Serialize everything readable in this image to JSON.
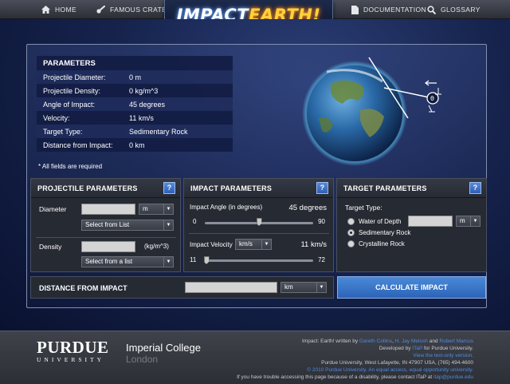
{
  "nav": {
    "home": "HOME",
    "famous_craters": "FAMOUS CRATERS",
    "documentation": "DOCUMENTATION",
    "glossary": "GLOSSARY",
    "logo_impact": "IMPACT",
    "logo_earth": "EARTH!"
  },
  "summary": {
    "heading": "PARAMETERS",
    "rows": [
      {
        "label": "Projectile Diameter:",
        "value": "0 m"
      },
      {
        "label": "Projectile Density:",
        "value": "0 kg/m^3"
      },
      {
        "label": "Angle of Impact:",
        "value": "45 degrees"
      },
      {
        "label": "Velocity:",
        "value": "11 km/s"
      },
      {
        "label": "Target Type:",
        "value": "Sedimentary Rock"
      },
      {
        "label": "Distance from Impact:",
        "value": "0 km"
      }
    ],
    "note": "* All fields are required"
  },
  "projectile": {
    "title": "PROJECTILE PARAMETERS",
    "help": "?",
    "diameter_label": "Diameter",
    "diameter_unit": "m",
    "diameter_select": "Select from List",
    "density_label": "Density",
    "density_unit": "(kg/m^3)",
    "density_select": "Select from a list"
  },
  "impact": {
    "title": "IMPACT PARAMETERS",
    "help": "?",
    "angle_label": "Impact Angle (in degrees)",
    "angle_value": "45 degrees",
    "angle_min": "0",
    "angle_max": "90",
    "angle_fraction": 0.5,
    "velocity_label": "Impact Velocity",
    "velocity_unit": "km/s",
    "velocity_value": "11 km/s",
    "velocity_min": "11",
    "velocity_max": "72",
    "velocity_fraction": 0.0
  },
  "target": {
    "title": "TARGET PARAMETERS",
    "help": "?",
    "type_label": "Target Type:",
    "water_label": "Water of Depth",
    "water_unit": "m",
    "sedimentary_label": "Sedimentary Rock",
    "crystalline_label": "Crystalline Rock",
    "selected": "sedimentary"
  },
  "distance": {
    "label": "DISTANCE FROM IMPACT",
    "unit": "km"
  },
  "calculate": "CALCULATE IMPACT",
  "footer": {
    "purdue": "PURDUE",
    "purdue_sub": "UNIVERSITY",
    "imperial": "Imperial College",
    "london": "London",
    "line1_pre": "Impact: Earth! written by",
    "line1_a": "Gareth Collins",
    "line1_sep1": ",",
    "line1_b": "H. Jay Melosh",
    "line1_and": "and",
    "line1_c": "Robert Marcus",
    "line2_pre": "Developed by",
    "line2_link": "ITaP",
    "line2_post": "for Purdue University.",
    "line3": "View the text-only version.",
    "line4": "Purdue University, West Lafayette, IN 47907 USA, (765) 494-4600",
    "line5": "© 2010 Purdue University. An equal access, equal opportunity university.",
    "line6_pre": "If you have trouble accessing this page because of a disability, please contact ITaP at",
    "line6_link": "itap@purdue.edu"
  },
  "colors": {
    "accent_blue": "#3a74c8",
    "panel_bg": "#262a33",
    "link": "#4f8be0"
  }
}
